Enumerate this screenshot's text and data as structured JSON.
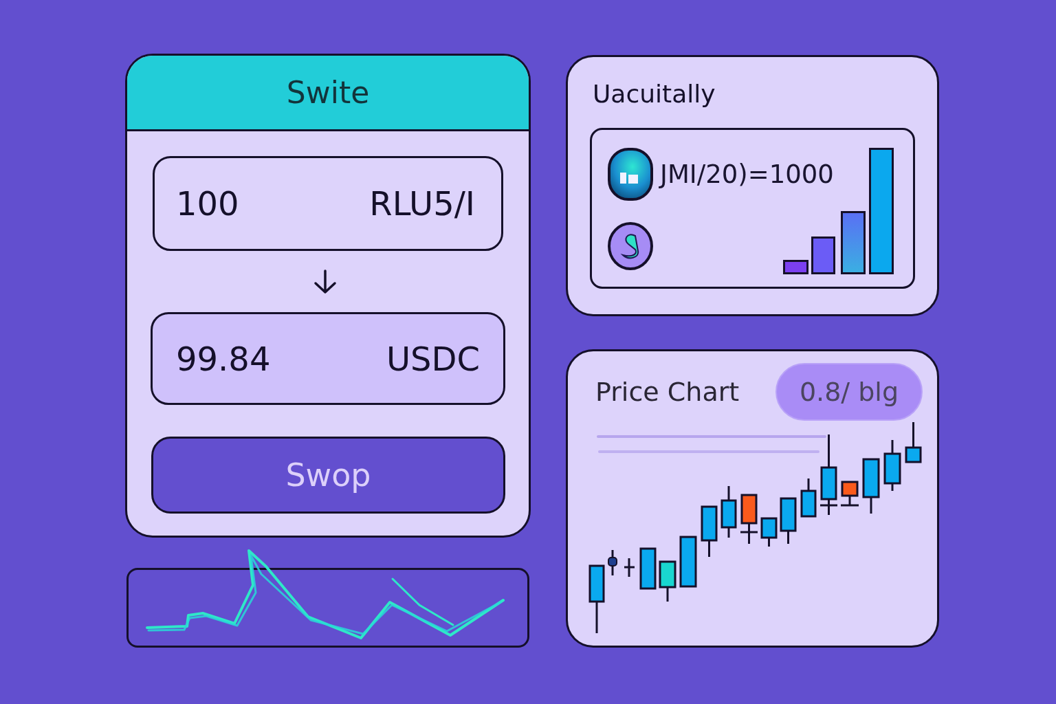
{
  "swap_card": {
    "title": "Swite",
    "from": {
      "amount": "100",
      "token": "RLU5/I"
    },
    "to": {
      "amount": "99.84",
      "token": "USDC"
    },
    "button": "Swop"
  },
  "liquidity_card": {
    "title": "Uacuitally",
    "pair": "JMI/20)=1000"
  },
  "price_chart_card": {
    "title": "Price Chart",
    "badge": "0.8/ blg"
  }
}
